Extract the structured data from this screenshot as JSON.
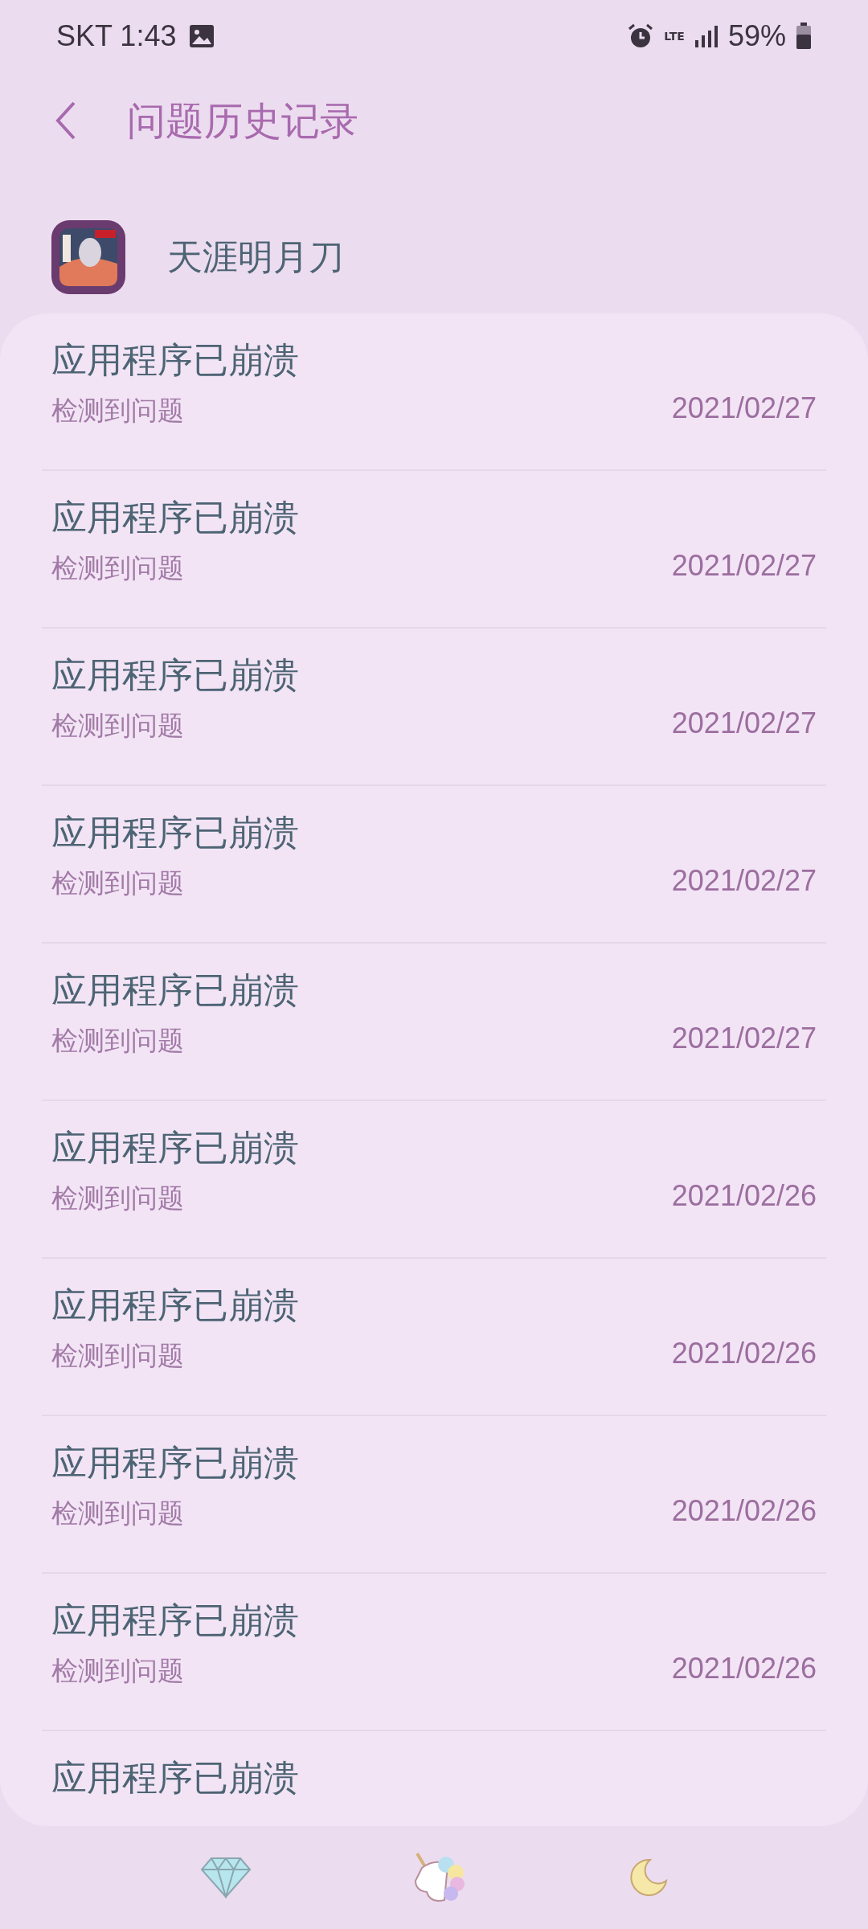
{
  "status_bar": {
    "carrier_time": "SKT 1:43",
    "network": "LTE",
    "battery": "59%"
  },
  "header": {
    "title": "问题历史记录"
  },
  "app": {
    "name": "天涯明月刀"
  },
  "entries": [
    {
      "title": "应用程序已崩溃",
      "subtitle": "检测到问题",
      "date": "2021/02/27"
    },
    {
      "title": "应用程序已崩溃",
      "subtitle": "检测到问题",
      "date": "2021/02/27"
    },
    {
      "title": "应用程序已崩溃",
      "subtitle": "检测到问题",
      "date": "2021/02/27"
    },
    {
      "title": "应用程序已崩溃",
      "subtitle": "检测到问题",
      "date": "2021/02/27"
    },
    {
      "title": "应用程序已崩溃",
      "subtitle": "检测到问题",
      "date": "2021/02/27"
    },
    {
      "title": "应用程序已崩溃",
      "subtitle": "检测到问题",
      "date": "2021/02/26"
    },
    {
      "title": "应用程序已崩溃",
      "subtitle": "检测到问题",
      "date": "2021/02/26"
    },
    {
      "title": "应用程序已崩溃",
      "subtitle": "检测到问题",
      "date": "2021/02/26"
    },
    {
      "title": "应用程序已崩溃",
      "subtitle": "检测到问题",
      "date": "2021/02/26"
    },
    {
      "title": "应用程序已崩溃"
    }
  ]
}
